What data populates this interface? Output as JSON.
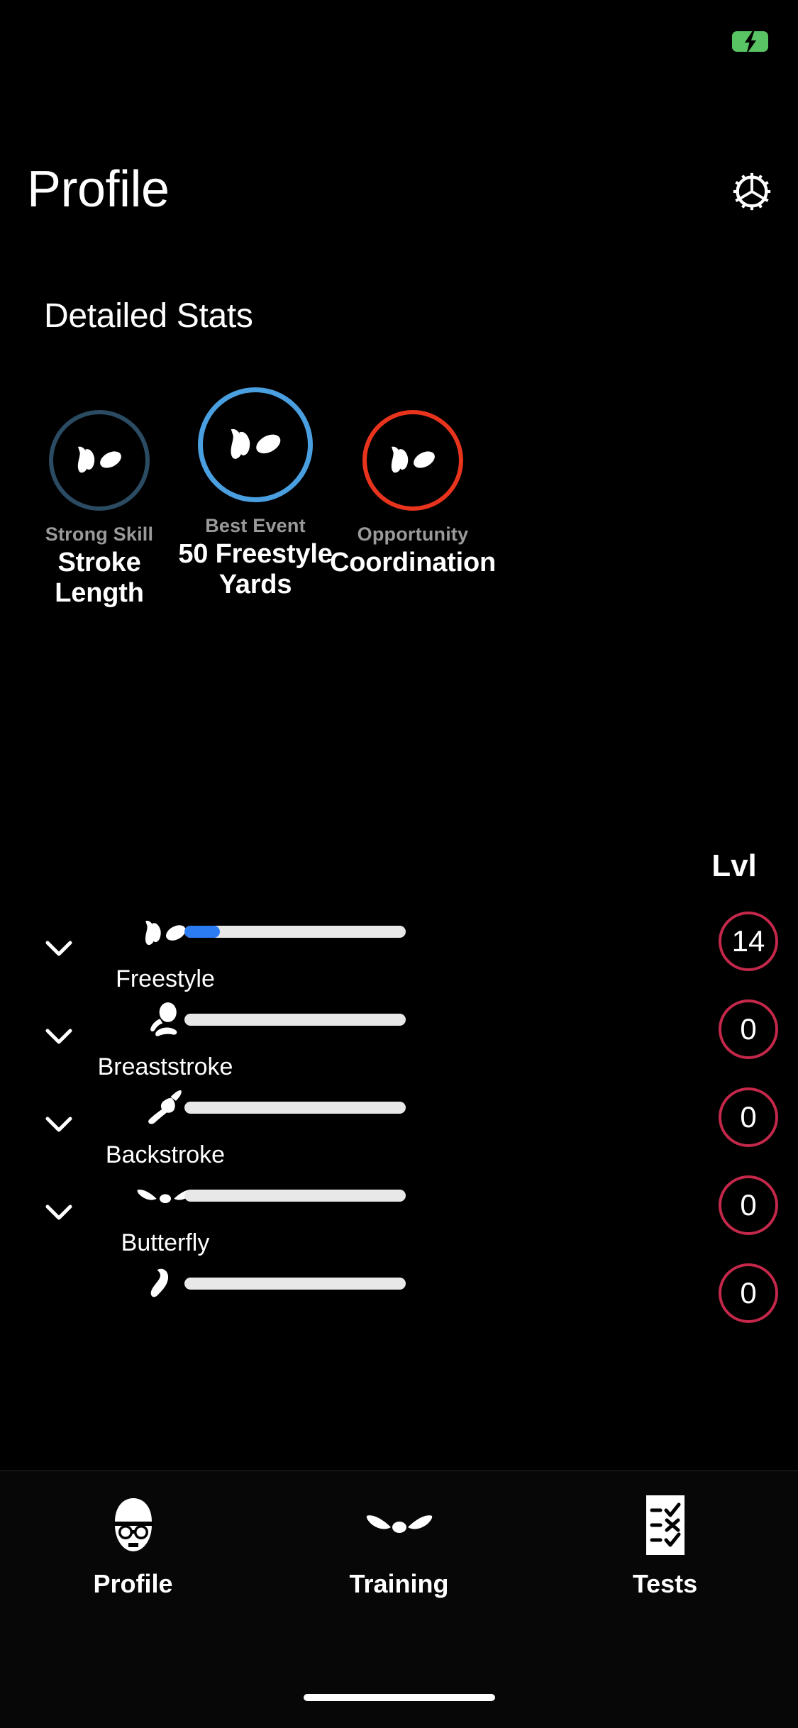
{
  "statusbar": {
    "battery_icon": "battery-charging-icon",
    "battery_color": "#58c463"
  },
  "header": {
    "title": "Profile",
    "settings_icon": "gear-icon"
  },
  "section": {
    "title": "Detailed Stats"
  },
  "stat_cards": [
    {
      "icon": "freestyle-swimmer-icon",
      "label": "Strong Skill",
      "value": "Stroke Length",
      "ring_color": "#2b4b63"
    },
    {
      "icon": "freestyle-swimmer-icon",
      "label": "Best Event",
      "value": "50 Freestyle Yards",
      "ring_color": "#4a9fe0"
    },
    {
      "icon": "freestyle-swimmer-icon",
      "label": "Opportunity",
      "value": "Coordination",
      "ring_color": "#e8331d"
    }
  ],
  "strokes": {
    "level_header": "Lvl",
    "rows": [
      {
        "name": "Freestyle",
        "icon": "freestyle-icon",
        "level": "14",
        "progress": 16
      },
      {
        "name": "Breaststroke",
        "icon": "breaststroke-icon",
        "level": "0",
        "progress": 0
      },
      {
        "name": "Backstroke",
        "icon": "backstroke-icon",
        "level": "0",
        "progress": 0
      },
      {
        "name": "Butterfly",
        "icon": "butterfly-icon",
        "level": "0",
        "progress": 0
      },
      {
        "name": "",
        "icon": "individual-medley-icon",
        "level": "0",
        "progress": 0
      }
    ],
    "badge_color": "#c3284a",
    "fill_color": "#2b7bf3",
    "track_color": "#e8e8e8"
  },
  "tabbar": {
    "tabs": [
      {
        "label": "Profile",
        "icon": "swimmer-head-icon",
        "active": true
      },
      {
        "label": "Training",
        "icon": "butterfly-wings-icon",
        "active": false
      },
      {
        "label": "Tests",
        "icon": "checklist-icon",
        "active": false
      }
    ]
  }
}
